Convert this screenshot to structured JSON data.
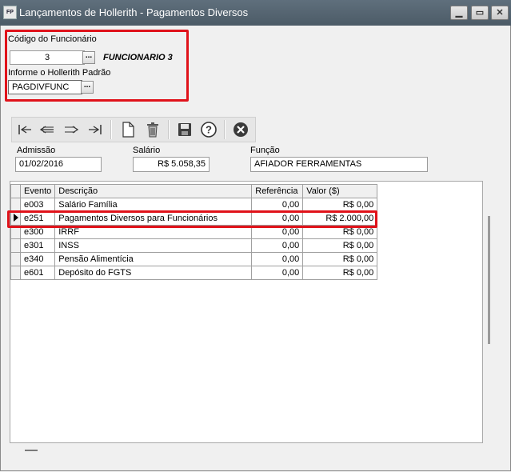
{
  "window": {
    "app_badge": "FP",
    "title": "Lançamentos de Hollerith - Pagamentos Diversos",
    "min_glyph": "▁",
    "max_glyph": "▭",
    "close_glyph": "✕"
  },
  "employee": {
    "code_label": "Código do Funcionário",
    "code_value": "3",
    "name": "FUNCIONARIO 3",
    "hollerith_label": "Informe o Hollerith Padrão",
    "hollerith_value": "PAGDIVFUNC",
    "lookup_glyph": "..."
  },
  "toolbar": {
    "icons": [
      "first-record-icon",
      "previous-record-icon",
      "next-record-icon",
      "last-record-icon",
      "new-document-icon",
      "delete-icon",
      "save-icon",
      "help-icon",
      "cancel-icon"
    ]
  },
  "info": {
    "admissao_label": "Admissão",
    "admissao_value": "01/02/2016",
    "salario_label": "Salário",
    "salario_value": "R$ 5.058,35",
    "funcao_label": "Função",
    "funcao_value": "AFIADOR FERRAMENTAS"
  },
  "grid": {
    "headers": [
      "Evento",
      "Descrição",
      "Referência",
      "Valor ($)"
    ],
    "rows": [
      {
        "evento": "e003",
        "descricao": "Salário Família",
        "referencia": "0,00",
        "valor": "R$ 0,00"
      },
      {
        "evento": "e251",
        "descricao": "Pagamentos Diversos para Funcionários",
        "referencia": "0,00",
        "valor": "R$ 2.000,00"
      },
      {
        "evento": "e300",
        "descricao": "IRRF",
        "referencia": "0,00",
        "valor": "R$ 0,00"
      },
      {
        "evento": "e301",
        "descricao": "INSS",
        "referencia": "0,00",
        "valor": "R$ 0,00"
      },
      {
        "evento": "e340",
        "descricao": "Pensão Alimentícia",
        "referencia": "0,00",
        "valor": "R$ 0,00"
      },
      {
        "evento": "e601",
        "descricao": "Depósito do FGTS",
        "referencia": "0,00",
        "valor": "R$ 0,00"
      }
    ],
    "selected_row": 1
  },
  "colors": {
    "highlight": "#e0121a",
    "titlebar": "#56646f"
  }
}
